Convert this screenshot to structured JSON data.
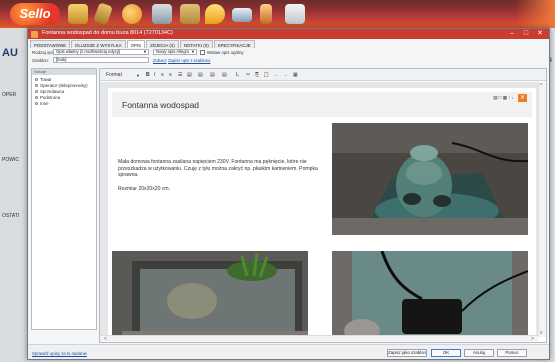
{
  "app": {
    "logo_text": "Sello",
    "toolbar_icons": [
      "gift-icon",
      "tools-icon",
      "globe-icon",
      "box-icon",
      "boxes-icon",
      "pin-icon",
      "truck-icon",
      "person-icon",
      "contacts-icon"
    ]
  },
  "background": {
    "left_big": "AU",
    "left_labels": [
      "OPER",
      "POWIC",
      "OSTATI"
    ],
    "right_label": "34"
  },
  "dialog": {
    "title": "Fontanna wodospad do domu biura 8014 (7270134C)",
    "tabs": [
      "PODSTAWOWE",
      "DLUZSZE Z WYSYLKA",
      "OPIS",
      "ZDJECIA (4)",
      "NOTATKI (0)",
      "SPECYFIKACJE"
    ],
    "active_tab": "OPIS",
    "form": {
      "type_label": "Rodzaj opisu:",
      "type_value": "Opis własny (z możliwością edycji)",
      "template_label": "Szablon:",
      "template_value": "[brak]",
      "format_value": "Nowy opis Allegro",
      "option_label": "Wstaw opis ogólny",
      "show_link": "Zobacz",
      "save_link": "Zapisz opis z szablonu"
    },
    "tree": {
      "header": "Sekcje",
      "items": [
        "Towar",
        "Operator (sklep/serwisy)",
        "Sprzedawca",
        "Podstrona",
        "Inne"
      ]
    },
    "editor": {
      "format_label": "Format",
      "toolbar": [
        "B",
        "I",
        "≡",
        "≡",
        "☰",
        "▤",
        "▤",
        "▤",
        "▤",
        "Iₓ",
        "✂",
        "⎘",
        "📋",
        "←",
        "→",
        "▦"
      ],
      "heading": "Fontanna wodospad",
      "description": "Mała domowa fontanna zasilana napięciem 230V. Fontanna ma pęknięcie, które nie przeszkadza w użytkowaniu. Czuję z tyłu można zakryć np. płaskim kamieniem. Pompka sprawna.",
      "size_text": "Rozmiar 20x20x20 cm.",
      "mini_tools": "↑ ↓ ✕"
    },
    "bottom": {
      "link": "Sprawdź opisy za to nadanie",
      "buttons": [
        "Zapisz jako szablon",
        "OK",
        "Anuluj",
        "Pomoc"
      ]
    }
  },
  "colors": {
    "accent": "#cc3b2f",
    "toolbar_gradient_top": "#6c2b2b",
    "toolbar_gradient_bottom": "#e4582a",
    "orange": "#f07a2a"
  }
}
